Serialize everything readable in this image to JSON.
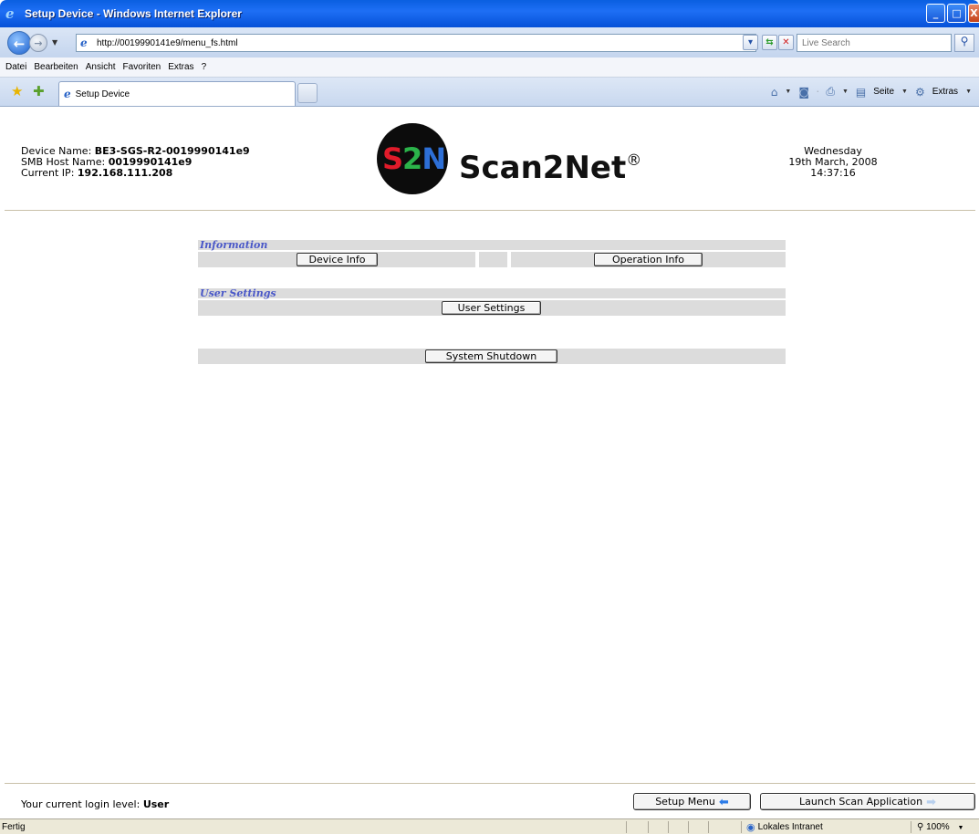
{
  "window": {
    "title": "Setup Device - Windows Internet Explorer",
    "buttons": {
      "minimize": "_",
      "maximize": "□",
      "close": "X"
    }
  },
  "address_bar": {
    "url": "http://0019990141e9/menu_fs.html",
    "search_placeholder": "Live Search"
  },
  "menu_bar": [
    "Datei",
    "Bearbeiten",
    "Ansicht",
    "Favoriten",
    "Extras",
    "?"
  ],
  "tabs": {
    "active": "Setup Device"
  },
  "command_bar": {
    "page": "Seite",
    "tools": "Extras"
  },
  "device": {
    "name_label": "Device Name: ",
    "name_value": "BE3-SGS-R2-0019990141e9",
    "smb_label": "SMB Host Name: ",
    "smb_value": "0019990141e9",
    "ip_label": "Current IP: ",
    "ip_value": "192.168.111.208"
  },
  "logo": {
    "mark": "S2N",
    "word": "Scan2Net",
    "reg": "®"
  },
  "datetime": {
    "day": "Wednesday",
    "date": "19th March, 2008",
    "time": "14:37:16"
  },
  "sections": {
    "information": {
      "heading": "Information",
      "device_info_button": "Device Info",
      "operation_info_button": "Operation Info"
    },
    "user_settings": {
      "heading": "User Settings",
      "button": "User Settings"
    },
    "system": {
      "shutdown_button": "System Shutdown"
    }
  },
  "footer": {
    "login_label": "Your current login level: ",
    "login_value": "User",
    "setup_menu_button": "Setup Menu",
    "launch_button": "Launch Scan Application"
  },
  "status_bar": {
    "status": "Fertig",
    "zone": "Lokales Intranet",
    "zoom": "100%"
  }
}
